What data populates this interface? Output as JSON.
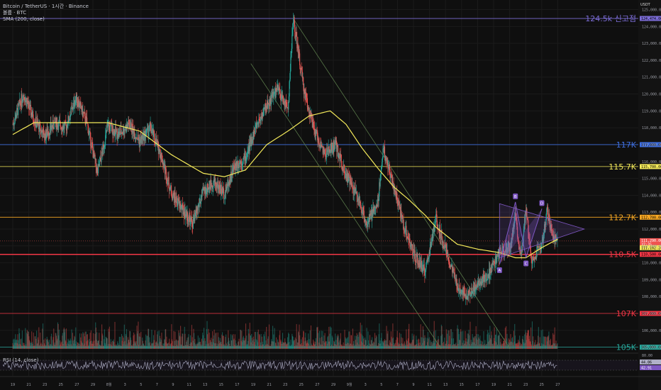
{
  "header": {
    "line1": "Bitcoin / TetherUS · 1시간 · Binance",
    "line2": "볼륨 · BTC",
    "line3": "SMA (200, close)",
    "rsi_label": "RSI (14, close)",
    "currency": "USDT"
  },
  "colors": {
    "background": "#0f0f0f",
    "candle_up": "#26a69a",
    "candle_down": "#ef5350",
    "sma": "#f3e95a",
    "level_ath": "#7b6cd6",
    "level_117k": "#3f6fe0",
    "level_115_7k": "#f3e95a",
    "level_112_7k": "#f5a623",
    "level_red": "#f23645",
    "level_105k": "#26a69a",
    "channel": "#5a7a4a",
    "pattern": "#7e57c2",
    "rsi": "#b0b0c8"
  },
  "chart_data": {
    "type": "line",
    "title": "Bitcoin / TetherUS · 1시간 · Binance",
    "yticks": [
      "125,000.00",
      "124,000.00",
      "123,000.00",
      "122,000.00",
      "121,000.00",
      "120,000.00",
      "119,000.00",
      "118,000.00",
      "117,000.00",
      "116,000.00",
      "115,000.00",
      "114,000.00",
      "113,000.00",
      "112,000.00",
      "111,000.00",
      "110,000.00",
      "109,000.00",
      "108,000.00",
      "107,000.00",
      "106,000.00",
      "105,000.00"
    ],
    "ylim": [
      104900,
      125400
    ],
    "xticks": [
      "19",
      "21",
      "23",
      "25",
      "27",
      "29",
      "8월",
      "3",
      "5",
      "7",
      "9",
      "11",
      "13",
      "15",
      "17",
      "19",
      "21",
      "23",
      "25",
      "27",
      "29",
      "9월",
      "3",
      "5",
      "7",
      "9",
      "11",
      "13",
      "15",
      "17",
      "19",
      "21",
      "23",
      "25",
      "27"
    ],
    "price_path": [
      [
        0,
        118200
      ],
      [
        2,
        120000
      ],
      [
        4,
        118500
      ],
      [
        6,
        117500
      ],
      [
        8,
        118300
      ],
      [
        10,
        118000
      ],
      [
        12,
        119800
      ],
      [
        14,
        118300
      ],
      [
        16,
        115300
      ],
      [
        18,
        118100
      ],
      [
        20,
        117600
      ],
      [
        22,
        118200
      ],
      [
        24,
        117200
      ],
      [
        26,
        118000
      ],
      [
        28,
        116400
      ],
      [
        30,
        114100
      ],
      [
        32,
        113200
      ],
      [
        34,
        112300
      ],
      [
        36,
        114200
      ],
      [
        38,
        114800
      ],
      [
        40,
        114100
      ],
      [
        42,
        115800
      ],
      [
        44,
        116200
      ],
      [
        46,
        118100
      ],
      [
        48,
        119300
      ],
      [
        50,
        120300
      ],
      [
        52,
        119100
      ],
      [
        53,
        124474
      ],
      [
        55,
        120300
      ],
      [
        57,
        117800
      ],
      [
        59,
        116400
      ],
      [
        61,
        117000
      ],
      [
        63,
        115200
      ],
      [
        65,
        114000
      ],
      [
        67,
        112300
      ],
      [
        69,
        113600
      ],
      [
        70,
        116800
      ],
      [
        72,
        114500
      ],
      [
        74,
        112100
      ],
      [
        76,
        110300
      ],
      [
        78,
        109500
      ],
      [
        80,
        112600
      ],
      [
        82,
        110600
      ],
      [
        84,
        108600
      ],
      [
        86,
        108100
      ],
      [
        88,
        108800
      ],
      [
        90,
        109300
      ],
      [
        92,
        110600
      ],
      [
        94,
        111000
      ],
      [
        95,
        112700
      ],
      [
        96,
        110400
      ],
      [
        97,
        113200
      ],
      [
        98,
        110200
      ],
      [
        100,
        111000
      ],
      [
        101,
        113100
      ],
      [
        102,
        111500
      ],
      [
        103,
        111300
      ]
    ],
    "sma_path": [
      [
        0,
        117600
      ],
      [
        4,
        118300
      ],
      [
        10,
        118300
      ],
      [
        18,
        118300
      ],
      [
        24,
        117800
      ],
      [
        30,
        116400
      ],
      [
        36,
        115300
      ],
      [
        40,
        115100
      ],
      [
        44,
        115500
      ],
      [
        48,
        117000
      ],
      [
        52,
        117800
      ],
      [
        56,
        118700
      ],
      [
        60,
        119000
      ],
      [
        63,
        118200
      ],
      [
        66,
        116800
      ],
      [
        69,
        115600
      ],
      [
        72,
        114500
      ],
      [
        75,
        113700
      ],
      [
        78,
        112800
      ],
      [
        80,
        112100
      ],
      [
        84,
        111100
      ],
      [
        88,
        110800
      ],
      [
        92,
        110600
      ],
      [
        95,
        110300
      ],
      [
        97,
        110300
      ],
      [
        100,
        110900
      ],
      [
        103,
        111400
      ]
    ],
    "levels": [
      {
        "label": "124.5k 신고점",
        "price": 124474,
        "price_text": "124,474.00",
        "color": "#7b6cd6"
      },
      {
        "label": "117K",
        "price": 117000,
        "price_text": "117,000.00",
        "color": "#3f6fe0"
      },
      {
        "label": "115.7K",
        "price": 115700,
        "price_text": "115,700.00",
        "color": "#f3e95a"
      },
      {
        "label": "112.7K",
        "price": 112700,
        "price_text": "112,700.00",
        "color": "#f5a623"
      },
      {
        "label": "110.5K",
        "price": 110500,
        "price_text": "110,500.00",
        "color": "#f23645"
      },
      {
        "label": "107K",
        "price": 107000,
        "price_text": "107,000.00",
        "color": "#f23645"
      },
      {
        "label": "105K",
        "price": 105000,
        "price_text": "105,000.00",
        "color": "#26a69a"
      }
    ],
    "current": {
      "price_text": "111,290.00",
      "time_text": "37:35",
      "sma_text": "111,102.24",
      "price": 111290,
      "sma": 111102
    },
    "pattern_labels": [
      "A",
      "B",
      "C",
      "D"
    ],
    "pattern_points": [
      [
        92,
        109900
      ],
      [
        95,
        113600
      ],
      [
        97,
        110300
      ],
      [
        100,
        113200
      ]
    ],
    "triangle": [
      [
        92,
        113500
      ],
      [
        108,
        112000
      ],
      [
        92,
        110300
      ]
    ],
    "rsi": {
      "values": [
        "44.86",
        "42.91"
      ],
      "upper": 70,
      "lower": 30,
      "level_text": "80.00"
    }
  }
}
